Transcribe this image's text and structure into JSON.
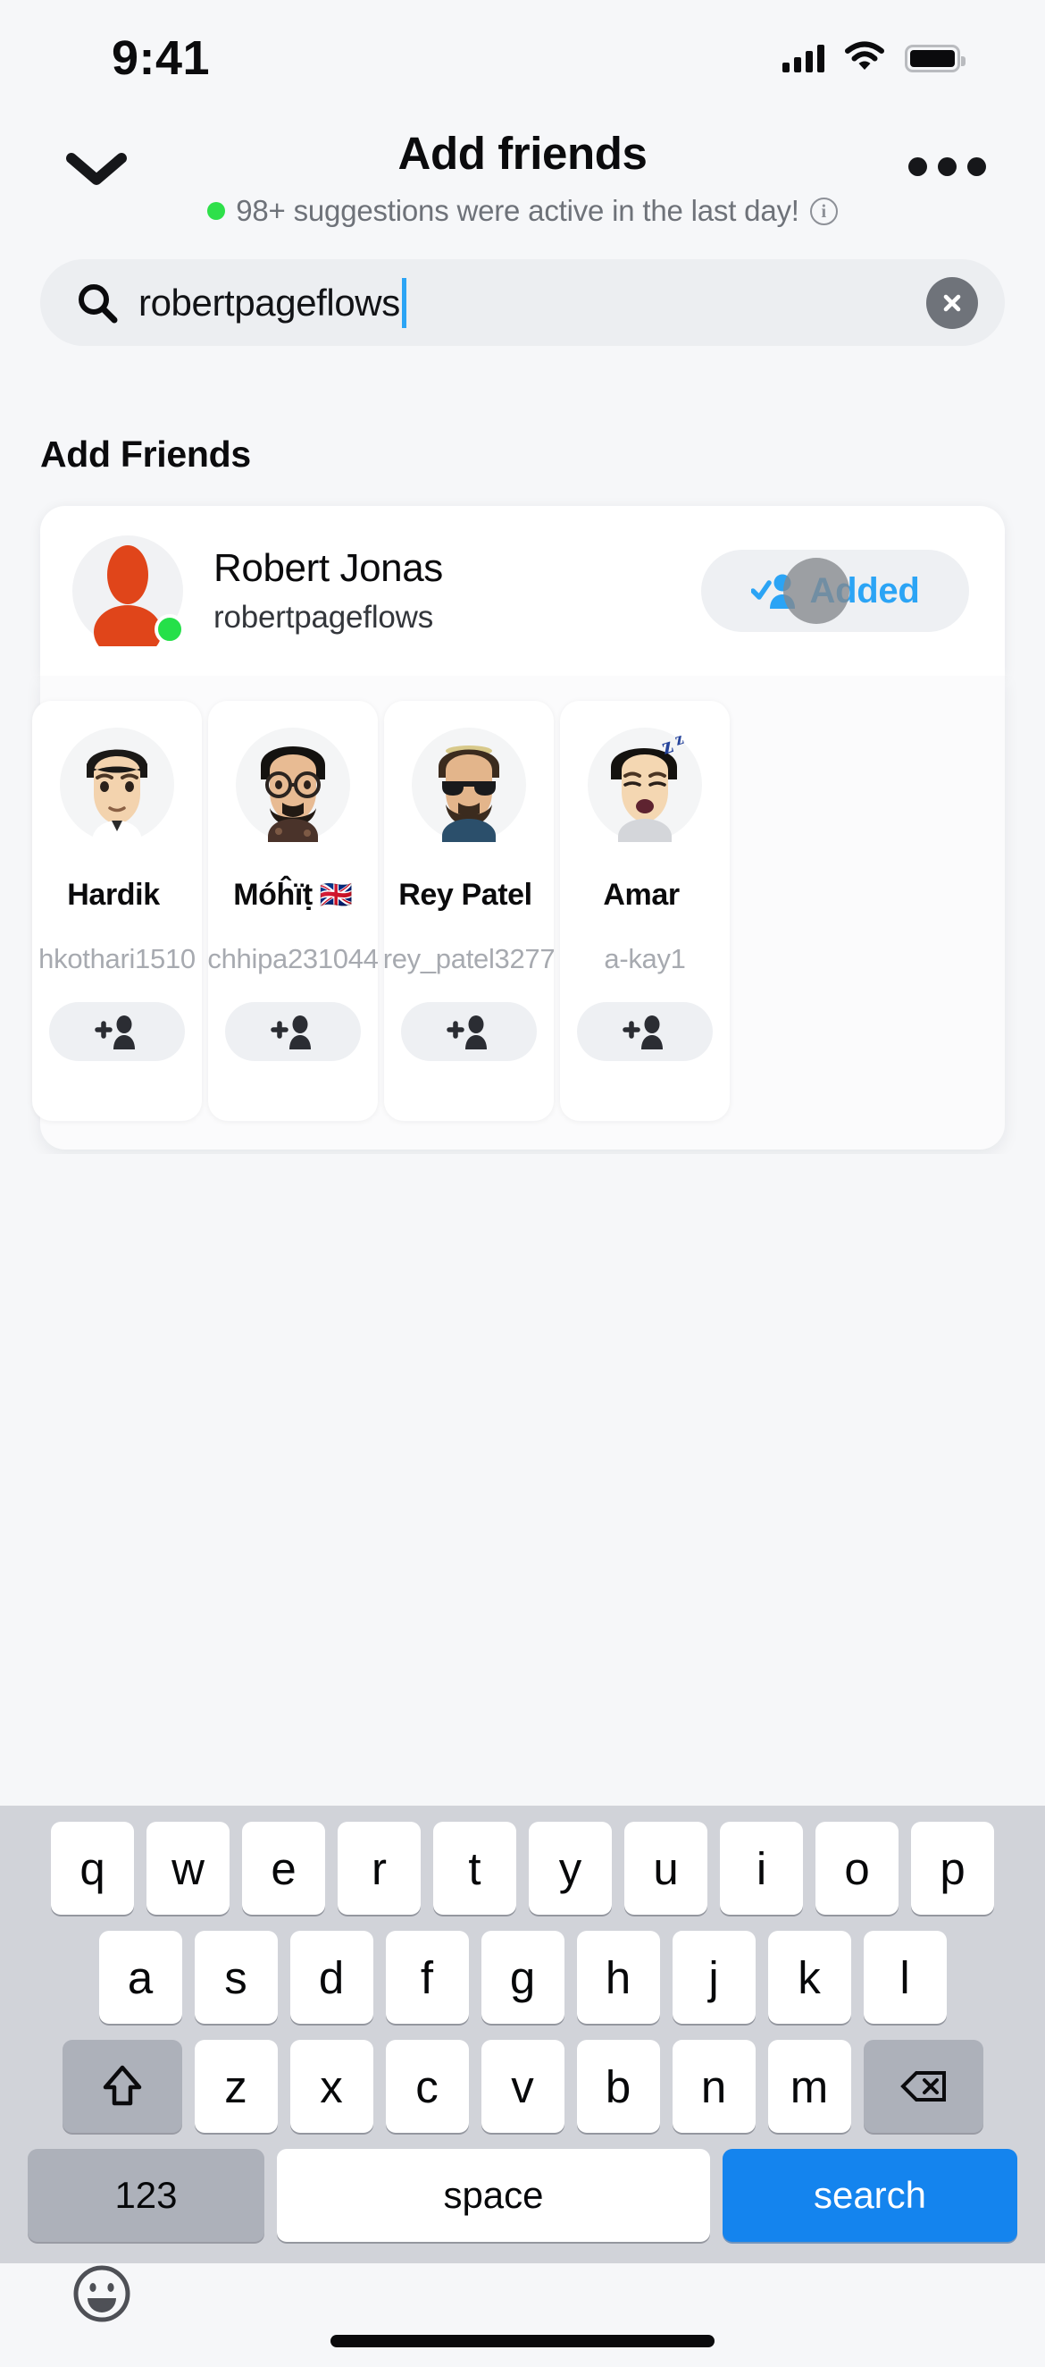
{
  "status_bar": {
    "time": "9:41",
    "signal_icon": "cellular-signal-icon",
    "wifi_icon": "wifi-icon",
    "battery_icon": "battery-icon"
  },
  "header": {
    "back_icon": "chevron-down-icon",
    "title": "Add friends",
    "more_icon": "more-options-icon",
    "subtitle": "98+ suggestions were active in the last day!",
    "status_dot_color": "#2ee04a",
    "info_icon": "info-icon",
    "info_glyph": "i"
  },
  "search": {
    "icon": "search-icon",
    "value": "robertpageflows",
    "placeholder": "Search",
    "clear_icon": "clear-icon",
    "caret_color": "#2ba4f5"
  },
  "main": {
    "section_title": "Add Friends",
    "result": {
      "avatar_icon": "person-avatar-icon",
      "avatar_color": "#e0451a",
      "online": true,
      "online_color": "#25e049",
      "display_name": "Robert Jonas",
      "username": "robertpageflows",
      "action_label": "Added",
      "action_icon": "person-check-icon",
      "action_color": "#2ba4f5",
      "tap_indicator": true
    },
    "suggestions": [
      {
        "avatar_icon": "bitmoji-avatar-icon",
        "name": "Hardik",
        "flag": "",
        "username": "hkothari1510",
        "add_icon": "add-person-icon"
      },
      {
        "avatar_icon": "bitmoji-avatar-icon",
        "name": "Móĥïṭ",
        "flag": "🇬🇧",
        "username": "chhipa231044",
        "add_icon": "add-person-icon"
      },
      {
        "avatar_icon": "bitmoji-avatar-icon",
        "name": "Rey Patel",
        "flag": "",
        "username": "rey_patel3277",
        "add_icon": "add-person-icon"
      },
      {
        "avatar_icon": "bitmoji-avatar-icon",
        "name": "Amar",
        "flag": "",
        "username": "a-kay1",
        "add_icon": "add-person-icon"
      }
    ]
  },
  "keyboard": {
    "row1": [
      "q",
      "w",
      "e",
      "r",
      "t",
      "y",
      "u",
      "i",
      "o",
      "p"
    ],
    "row2": [
      "a",
      "s",
      "d",
      "f",
      "g",
      "h",
      "j",
      "k",
      "l"
    ],
    "row3": [
      "z",
      "x",
      "c",
      "v",
      "b",
      "n",
      "m"
    ],
    "shift_icon": "shift-icon",
    "backspace_icon": "backspace-icon",
    "numbers_label": "123",
    "space_label": "space",
    "return_label": "search",
    "return_color": "#1484ee",
    "emoji_icon": "emoji-icon"
  },
  "home_indicator": "home-indicator"
}
